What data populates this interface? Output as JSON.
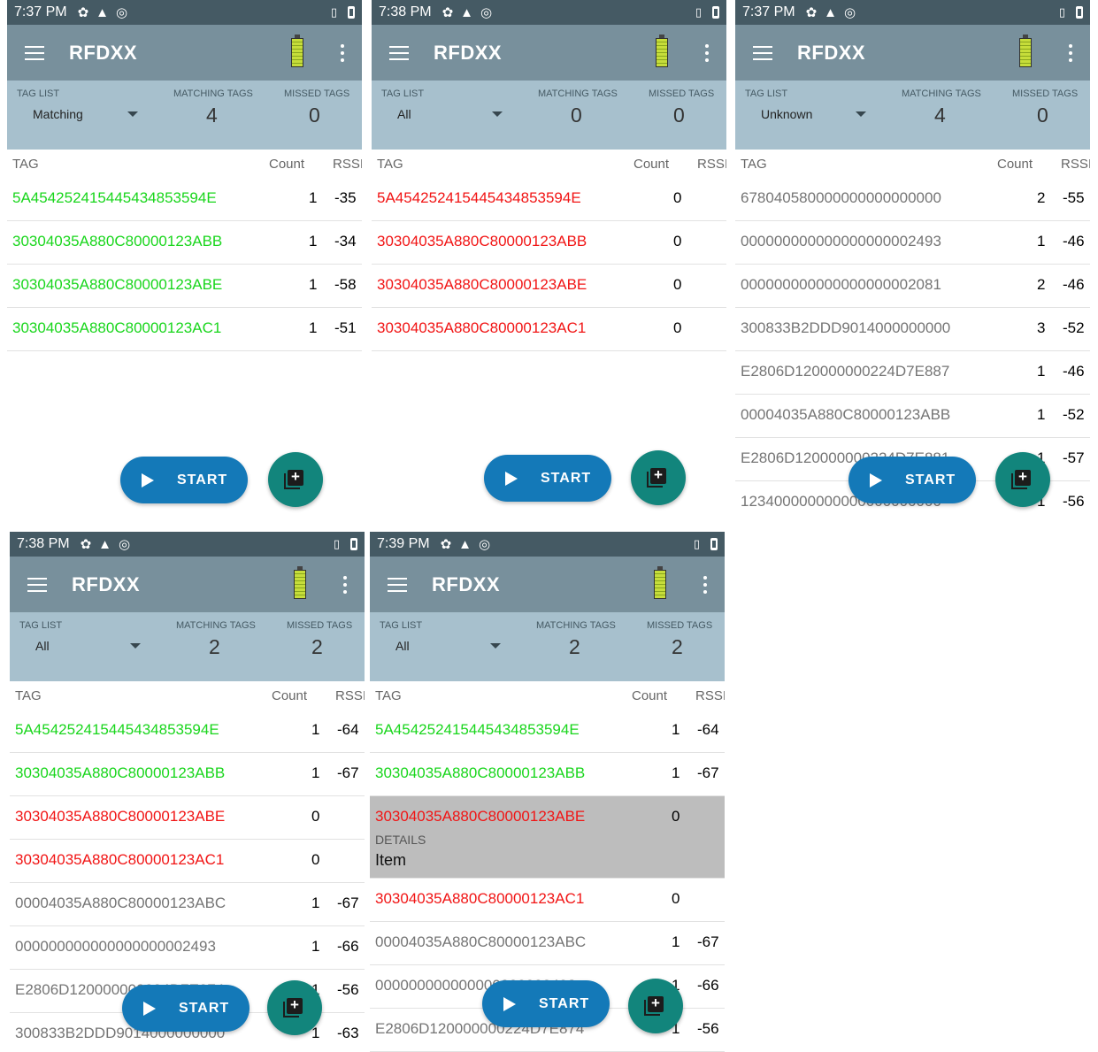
{
  "app": {
    "title": "RFDXX",
    "labels": {
      "tag_list": "TAG LIST",
      "matching": "MATCHING TAGS",
      "missed": "MISSED TAGS"
    },
    "table_headers": {
      "tag": "TAG",
      "count": "Count",
      "rssi": "RSSI"
    },
    "start_label": "START"
  },
  "screens": [
    {
      "time": "7:37 PM",
      "filter": "Matching",
      "matching": "4",
      "missed": "0",
      "rows": [
        {
          "tag": "5A454252415445434853594E",
          "count": "1",
          "rssi": "-35",
          "color": "green"
        },
        {
          "tag": "30304035A880C80000123ABB",
          "count": "1",
          "rssi": "-34",
          "color": "green"
        },
        {
          "tag": "30304035A880C80000123ABE",
          "count": "1",
          "rssi": "-58",
          "color": "green"
        },
        {
          "tag": "30304035A880C80000123AC1",
          "count": "1",
          "rssi": "-51",
          "color": "green"
        }
      ]
    },
    {
      "time": "7:38 PM",
      "filter": "All",
      "matching": "0",
      "missed": "0",
      "rows": [
        {
          "tag": "5A454252415445434853594E",
          "count": "0",
          "rssi": "",
          "color": "red"
        },
        {
          "tag": "30304035A880C80000123ABB",
          "count": "0",
          "rssi": "",
          "color": "red"
        },
        {
          "tag": "30304035A880C80000123ABE",
          "count": "0",
          "rssi": "",
          "color": "red"
        },
        {
          "tag": "30304035A880C80000123AC1",
          "count": "0",
          "rssi": "",
          "color": "red"
        }
      ]
    },
    {
      "time": "7:37 PM",
      "filter": "Unknown",
      "matching": "4",
      "missed": "0",
      "rows": [
        {
          "tag": "678040580000000000000000",
          "count": "2",
          "rssi": "-55",
          "color": "gray"
        },
        {
          "tag": "000000000000000000002493",
          "count": "1",
          "rssi": "-46",
          "color": "gray"
        },
        {
          "tag": "000000000000000000002081",
          "count": "2",
          "rssi": "-46",
          "color": "gray"
        },
        {
          "tag": "300833B2DDD9014000000000",
          "count": "3",
          "rssi": "-52",
          "color": "gray"
        },
        {
          "tag": "E2806D120000000224D7E887",
          "count": "1",
          "rssi": "-46",
          "color": "gray"
        },
        {
          "tag": "00004035A880C80000123ABB",
          "count": "1",
          "rssi": "-52",
          "color": "gray"
        },
        {
          "tag": "E2806D120000000224D7E881",
          "count": "1",
          "rssi": "-57",
          "color": "gray"
        },
        {
          "tag": "123400000000000000000000",
          "count": "1",
          "rssi": "-56",
          "color": "gray"
        }
      ]
    },
    {
      "time": "7:38 PM",
      "filter": "All",
      "matching": "2",
      "missed": "2",
      "rows": [
        {
          "tag": "5A454252415445434853594E",
          "count": "1",
          "rssi": "-64",
          "color": "green"
        },
        {
          "tag": "30304035A880C80000123ABB",
          "count": "1",
          "rssi": "-67",
          "color": "green"
        },
        {
          "tag": "30304035A880C80000123ABE",
          "count": "0",
          "rssi": "",
          "color": "red"
        },
        {
          "tag": "30304035A880C80000123AC1",
          "count": "0",
          "rssi": "",
          "color": "red"
        },
        {
          "tag": "00004035A880C80000123ABC",
          "count": "1",
          "rssi": "-67",
          "color": "gray"
        },
        {
          "tag": "000000000000000000002493",
          "count": "1",
          "rssi": "-66",
          "color": "gray"
        },
        {
          "tag": "E2806D120000000224D7E874",
          "count": "1",
          "rssi": "-56",
          "color": "gray"
        },
        {
          "tag": "300833B2DDD9014000000000",
          "count": "1",
          "rssi": "-63",
          "color": "gray"
        }
      ]
    },
    {
      "time": "7:39 PM",
      "filter": "All",
      "matching": "2",
      "missed": "2",
      "rows": [
        {
          "tag": "5A454252415445434853594E",
          "count": "1",
          "rssi": "-64",
          "color": "green"
        },
        {
          "tag": "30304035A880C80000123ABB",
          "count": "1",
          "rssi": "-67",
          "color": "green"
        },
        {
          "tag": "30304035A880C80000123ABE",
          "count": "0",
          "rssi": "",
          "color": "red",
          "details_label": "DETAILS",
          "details_value": "Item"
        },
        {
          "tag": "30304035A880C80000123AC1",
          "count": "0",
          "rssi": "",
          "color": "red"
        },
        {
          "tag": "00004035A880C80000123ABC",
          "count": "1",
          "rssi": "-67",
          "color": "gray"
        },
        {
          "tag": "000000000000000000002493",
          "count": "1",
          "rssi": "-66",
          "color": "gray"
        },
        {
          "tag": "E2806D120000000224D7E874",
          "count": "1",
          "rssi": "-56",
          "color": "gray"
        }
      ]
    }
  ]
}
